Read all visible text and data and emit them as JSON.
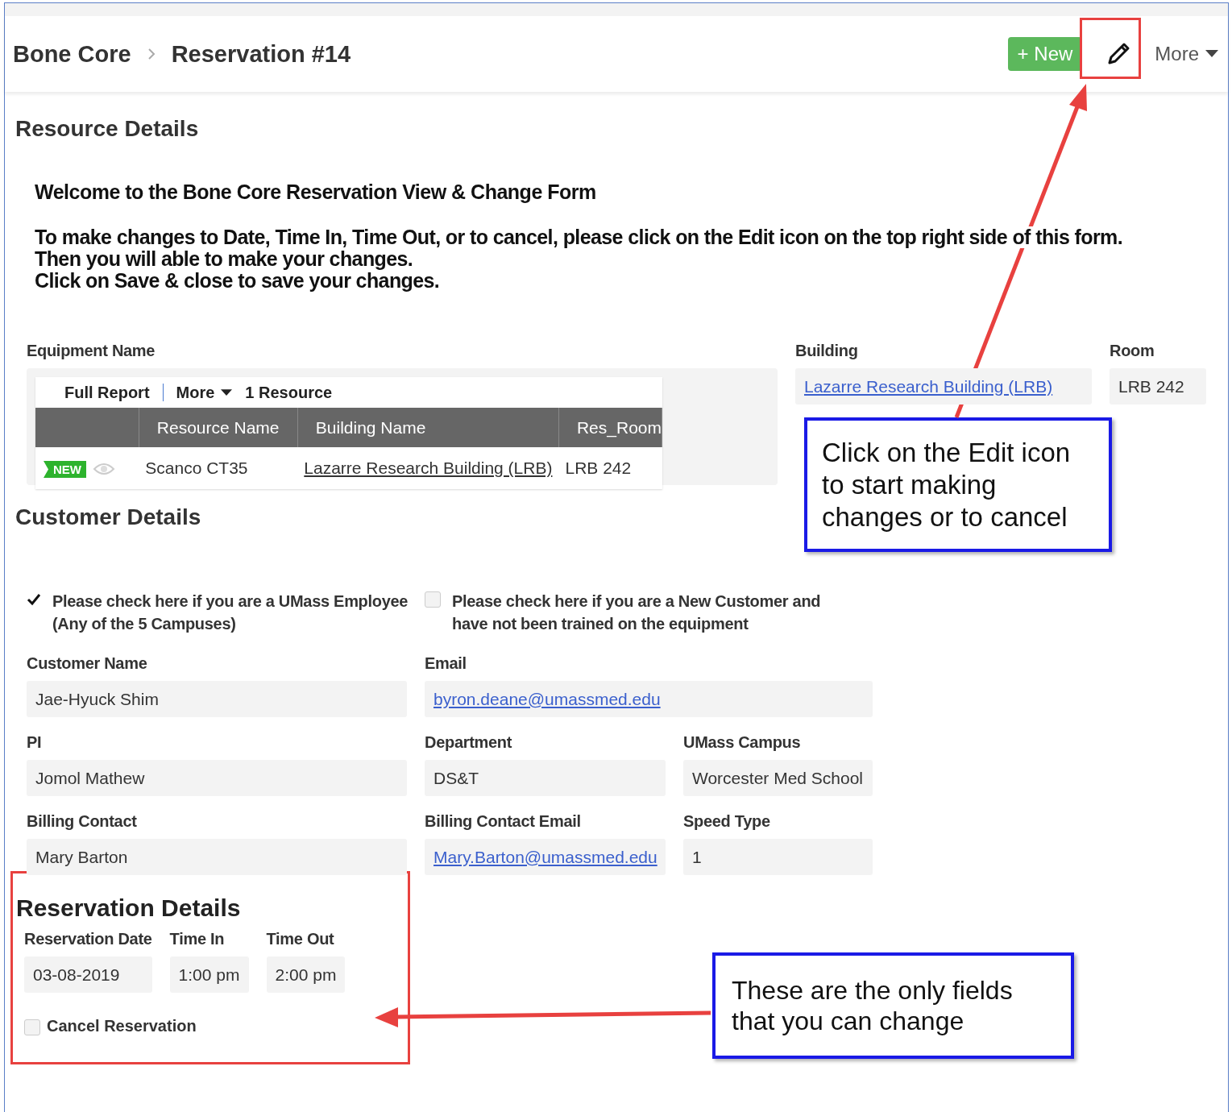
{
  "header": {
    "breadcrumb": [
      "Bone Core",
      "Reservation #14"
    ],
    "new_button": "+ New",
    "more_menu": "More"
  },
  "resource_section": {
    "title": "Resource Details",
    "welcome": "Welcome to the Bone Core Reservation View & Change Form",
    "instructions": [
      "To make changes to Date, Time In, Time Out, or to cancel, please click on the Edit icon on the top right side of this form.",
      "Then you will able to make your changes.",
      "Click on Save & close to save your changes."
    ]
  },
  "equipment": {
    "label": "Equipment Name",
    "toolbar": {
      "full_report": "Full Report",
      "more": "More",
      "count": "1 Resource"
    },
    "columns": [
      "Resource Name",
      "Building Name",
      "Res_Room"
    ],
    "rows": [
      {
        "badge": "NEW",
        "resource_name": "Scanco  CT35",
        "building_name": "Lazarre Research Building (LRB)",
        "res_room": "LRB 242"
      }
    ]
  },
  "building": {
    "label": "Building",
    "value": "Lazarre Research Building (LRB)"
  },
  "room": {
    "label": "Room",
    "value": "LRB 242"
  },
  "customer_section": {
    "title": "Customer Details",
    "checkboxes": [
      {
        "label": "Please check here if you are a UMass Employee (Any of the 5 Campuses)",
        "checked": true
      },
      {
        "label": "Please check here if you are a New Customer and have not been trained on the equipment",
        "checked": false
      }
    ],
    "rows": [
      [
        {
          "label": "Customer Name",
          "value": "Jae-Hyuck Shim",
          "kind": "text",
          "wide": false
        },
        {
          "label": "Email",
          "value": "byron.deane@umassmed.edu",
          "kind": "link",
          "wide": true
        }
      ],
      [
        {
          "label": "PI",
          "value": "Jomol Mathew",
          "kind": "text",
          "wide": false
        },
        {
          "label": "Department",
          "value": "DS&T",
          "kind": "text",
          "wide": false
        },
        {
          "label": "UMass Campus",
          "value": "Worcester Med School",
          "kind": "text",
          "wide": false
        }
      ],
      [
        {
          "label": "Billing Contact",
          "value": "Mary Barton",
          "kind": "text",
          "wide": false
        },
        {
          "label": "Billing Contact Email",
          "value": "Mary.Barton@umassmed.edu",
          "kind": "link",
          "wide": false
        },
        {
          "label": "Speed Type",
          "value": "1",
          "kind": "text",
          "wide": false
        }
      ]
    ]
  },
  "reservation_section": {
    "title": "Reservation Details",
    "fields": [
      {
        "label": "Reservation Date",
        "value": "03-08-2019"
      },
      {
        "label": "Time In",
        "value": "1:00 pm"
      },
      {
        "label": "Time Out",
        "value": "2:00 pm"
      }
    ],
    "cancel": {
      "label": "Cancel Reservation",
      "checked": false
    }
  },
  "callouts": [
    {
      "text": "Click on the Edit icon to start making changes or to cancel"
    },
    {
      "text": "These are the only fields that you can change"
    }
  ]
}
